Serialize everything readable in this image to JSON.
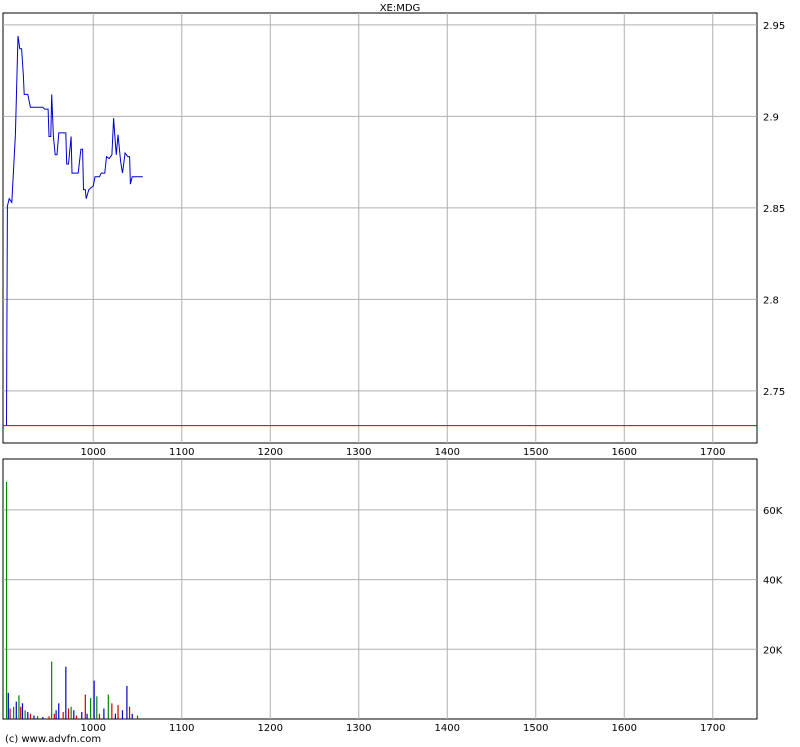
{
  "chart_data": [
    {
      "type": "line",
      "title": "XE:MDG",
      "xlabel": "",
      "ylabel": "",
      "xlim": [
        898,
        1750
      ],
      "ylim": [
        2.7215,
        2.9565
      ],
      "x_ticks": [
        1000,
        1100,
        1200,
        1300,
        1400,
        1500,
        1600,
        1700
      ],
      "y_ticks": [
        2.95,
        2.9,
        2.85,
        2.8,
        2.75
      ],
      "y_tick_labels": [
        "2.95",
        "2.9",
        "2.85",
        "2.8",
        "2.75"
      ],
      "grid": true,
      "reference_line": {
        "y": 2.731,
        "color": "#cc0000"
      },
      "series": [
        {
          "color": "#0000cc",
          "points": [
            [
              902,
              2.731
            ],
            [
              903,
              2.851
            ],
            [
              905,
              2.855
            ],
            [
              908,
              2.853
            ],
            [
              912,
              2.89
            ],
            [
              915,
              2.944
            ],
            [
              917,
              2.937
            ],
            [
              919,
              2.937
            ],
            [
              921,
              2.922
            ],
            [
              922,
              2.912
            ],
            [
              926,
              2.912
            ],
            [
              929,
              2.905
            ],
            [
              936,
              2.905
            ],
            [
              943,
              2.905
            ],
            [
              945,
              2.904
            ],
            [
              949,
              2.904
            ],
            [
              950,
              2.889
            ],
            [
              952,
              2.889
            ],
            [
              953,
              2.912
            ],
            [
              955,
              2.889
            ],
            [
              957,
              2.879
            ],
            [
              959,
              2.879
            ],
            [
              961,
              2.891
            ],
            [
              969,
              2.891
            ],
            [
              970,
              2.874
            ],
            [
              972,
              2.874
            ],
            [
              975,
              2.889
            ],
            [
              976,
              2.869
            ],
            [
              983,
              2.869
            ],
            [
              986,
              2.882
            ],
            [
              988,
              2.882
            ],
            [
              989,
              2.86
            ],
            [
              991,
              2.86
            ],
            [
              992,
              2.855
            ],
            [
              995,
              2.86
            ],
            [
              1000,
              2.862
            ],
            [
              1002,
              2.867
            ],
            [
              1007,
              2.867
            ],
            [
              1009,
              2.869
            ],
            [
              1013,
              2.869
            ],
            [
              1015,
              2.878
            ],
            [
              1018,
              2.877
            ],
            [
              1021,
              2.879
            ],
            [
              1023,
              2.899
            ],
            [
              1025,
              2.885
            ],
            [
              1026,
              2.879
            ],
            [
              1028,
              2.89
            ],
            [
              1031,
              2.875
            ],
            [
              1033,
              2.869
            ],
            [
              1036,
              2.88
            ],
            [
              1039,
              2.878
            ],
            [
              1041,
              2.878
            ],
            [
              1042,
              2.863
            ],
            [
              1044,
              2.867
            ],
            [
              1056,
              2.867
            ]
          ]
        }
      ]
    },
    {
      "type": "bar",
      "title": "",
      "xlabel": "",
      "ylabel": "",
      "xlim": [
        898,
        1750
      ],
      "ylim": [
        0,
        74600
      ],
      "x_ticks": [
        1000,
        1100,
        1200,
        1300,
        1400,
        1500,
        1600,
        1700
      ],
      "y_ticks": [
        20000,
        40000,
        60000
      ],
      "y_tick_labels": [
        "20K",
        "40K",
        "60K"
      ],
      "grid": true,
      "bars": [
        {
          "x": 902,
          "value": 68000,
          "color": "#008800"
        },
        {
          "x": 904,
          "value": 7500,
          "color": "#0000cc"
        },
        {
          "x": 906,
          "value": 3000,
          "color": "#cc0000"
        },
        {
          "x": 910,
          "value": 3500,
          "color": "#008800"
        },
        {
          "x": 913,
          "value": 5000,
          "color": "#0000cc"
        },
        {
          "x": 916,
          "value": 6800,
          "color": "#008800"
        },
        {
          "x": 918,
          "value": 3500,
          "color": "#cc0000"
        },
        {
          "x": 920,
          "value": 4500,
          "color": "#0000cc"
        },
        {
          "x": 923,
          "value": 2500,
          "color": "#008800"
        },
        {
          "x": 926,
          "value": 2000,
          "color": "#0000cc"
        },
        {
          "x": 929,
          "value": 1500,
          "color": "#cc0000"
        },
        {
          "x": 933,
          "value": 1000,
          "color": "#0000cc"
        },
        {
          "x": 937,
          "value": 800,
          "color": "#cc0000"
        },
        {
          "x": 943,
          "value": 600,
          "color": "#0000cc"
        },
        {
          "x": 950,
          "value": 800,
          "color": "#cc0000"
        },
        {
          "x": 953,
          "value": 16500,
          "color": "#008800"
        },
        {
          "x": 956,
          "value": 1500,
          "color": "#cc0000"
        },
        {
          "x": 958,
          "value": 2500,
          "color": "#0000cc"
        },
        {
          "x": 961,
          "value": 4500,
          "color": "#0000cc"
        },
        {
          "x": 966,
          "value": 2000,
          "color": "#cc0000"
        },
        {
          "x": 969,
          "value": 15000,
          "color": "#0000cc"
        },
        {
          "x": 972,
          "value": 3000,
          "color": "#cc0000"
        },
        {
          "x": 975,
          "value": 3500,
          "color": "#008800"
        },
        {
          "x": 978,
          "value": 2500,
          "color": "#0000cc"
        },
        {
          "x": 981,
          "value": 1000,
          "color": "#cc0000"
        },
        {
          "x": 987,
          "value": 2000,
          "color": "#0000cc"
        },
        {
          "x": 991,
          "value": 7000,
          "color": "#cc0000"
        },
        {
          "x": 993,
          "value": 1500,
          "color": "#0000cc"
        },
        {
          "x": 997,
          "value": 6000,
          "color": "#008800"
        },
        {
          "x": 1001,
          "value": 11000,
          "color": "#0000cc"
        },
        {
          "x": 1004,
          "value": 6500,
          "color": "#008800"
        },
        {
          "x": 1007,
          "value": 1500,
          "color": "#cc0000"
        },
        {
          "x": 1012,
          "value": 3000,
          "color": "#0000cc"
        },
        {
          "x": 1017,
          "value": 7000,
          "color": "#008800"
        },
        {
          "x": 1021,
          "value": 4500,
          "color": "#cc0000"
        },
        {
          "x": 1025,
          "value": 1500,
          "color": "#0000cc"
        },
        {
          "x": 1028,
          "value": 4000,
          "color": "#cc0000"
        },
        {
          "x": 1033,
          "value": 2500,
          "color": "#0000cc"
        },
        {
          "x": 1038,
          "value": 9500,
          "color": "#0000cc"
        },
        {
          "x": 1041,
          "value": 3500,
          "color": "#cc0000"
        },
        {
          "x": 1044,
          "value": 1500,
          "color": "#0000cc"
        },
        {
          "x": 1050,
          "value": 1000,
          "color": "#cc0000"
        }
      ]
    }
  ],
  "footer": {
    "credit": "(c) www.advfn.com"
  }
}
